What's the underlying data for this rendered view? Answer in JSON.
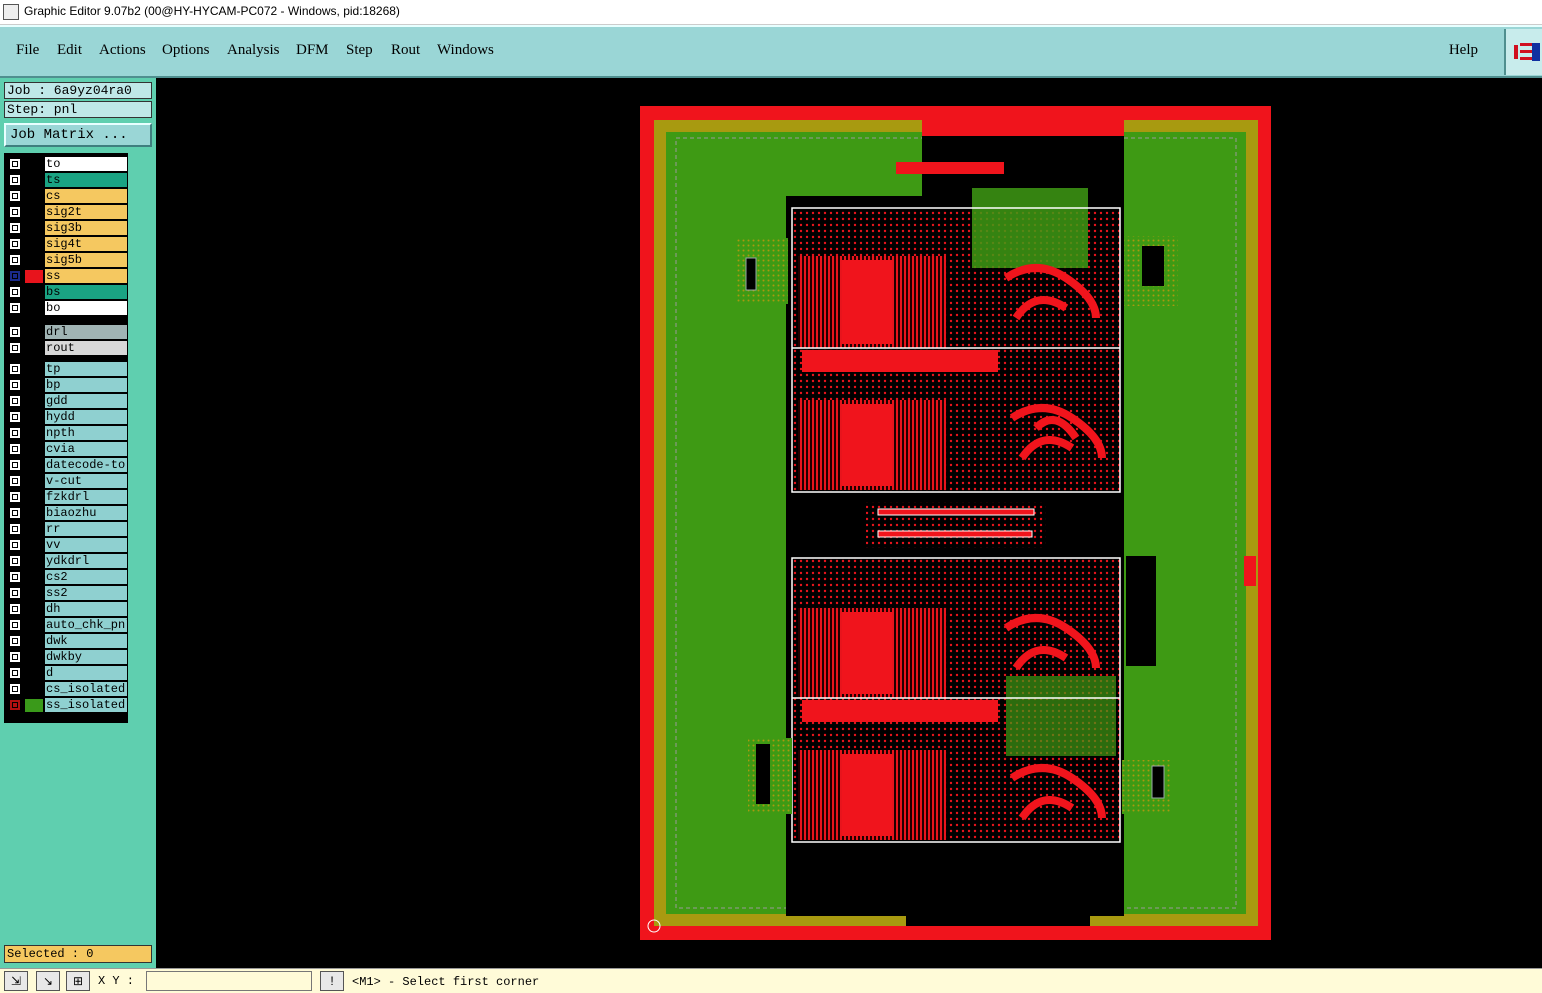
{
  "window": {
    "title": "Graphic Editor 9.07b2 (00@HY-HYCAM-PC072 - Windows, pid:18268)"
  },
  "menu": {
    "items": [
      "File",
      "Edit",
      "Actions",
      "Options",
      "Analysis",
      "DFM",
      "Step",
      "Rout",
      "Windows"
    ],
    "help": "Help"
  },
  "panel": {
    "job": "Job : 6a9yz04ra0",
    "step": "Step: pnl",
    "job_matrix": "Job Matrix ...",
    "selected": "Selected : 0"
  },
  "layers": [
    {
      "name": "to",
      "bg": "#ffffff",
      "swatch": "#000000"
    },
    {
      "name": "ts",
      "bg": "#1aa383",
      "swatch": "#000000"
    },
    {
      "name": "cs",
      "bg": "#f5c860",
      "swatch": "#000000"
    },
    {
      "name": "sig2t",
      "bg": "#f5c860",
      "swatch": "#000000"
    },
    {
      "name": "sig3b",
      "bg": "#f5c860",
      "swatch": "#000000"
    },
    {
      "name": "sig4t",
      "bg": "#f5c860",
      "swatch": "#000000"
    },
    {
      "name": "sig5b",
      "bg": "#f5c860",
      "swatch": "#000000"
    },
    {
      "name": "ss",
      "bg": "#f5c860",
      "swatch": "#e8141c",
      "active": true
    },
    {
      "name": "bs",
      "bg": "#1aa383",
      "swatch": "#000000"
    },
    {
      "name": "bo",
      "bg": "#ffffff",
      "swatch": "#000000"
    },
    {
      "name": "drl",
      "bg": "#a0b4b4",
      "swatch": "#000000"
    },
    {
      "name": "rout",
      "bg": "#d8d8d8",
      "swatch": "#000000"
    },
    {
      "name": "tp",
      "bg": "#8fd0d0",
      "swatch": "#000000"
    },
    {
      "name": "bp",
      "bg": "#8fd0d0",
      "swatch": "#000000"
    },
    {
      "name": "gdd",
      "bg": "#8fd0d0",
      "swatch": "#000000"
    },
    {
      "name": "hydd",
      "bg": "#8fd0d0",
      "swatch": "#000000"
    },
    {
      "name": "npth",
      "bg": "#8fd0d0",
      "swatch": "#000000"
    },
    {
      "name": "cvia",
      "bg": "#8fd0d0",
      "swatch": "#000000"
    },
    {
      "name": "datecode-to",
      "bg": "#8fd0d0",
      "swatch": "#000000"
    },
    {
      "name": "v-cut",
      "bg": "#8fd0d0",
      "swatch": "#000000"
    },
    {
      "name": "fzkdrl",
      "bg": "#8fd0d0",
      "swatch": "#000000"
    },
    {
      "name": "biaozhu",
      "bg": "#8fd0d0",
      "swatch": "#000000"
    },
    {
      "name": "rr",
      "bg": "#8fd0d0",
      "swatch": "#000000"
    },
    {
      "name": "vv",
      "bg": "#8fd0d0",
      "swatch": "#000000"
    },
    {
      "name": "ydkdrl",
      "bg": "#8fd0d0",
      "swatch": "#000000"
    },
    {
      "name": "cs2",
      "bg": "#8fd0d0",
      "swatch": "#000000"
    },
    {
      "name": "ss2",
      "bg": "#8fd0d0",
      "swatch": "#000000"
    },
    {
      "name": "dh",
      "bg": "#8fd0d0",
      "swatch": "#000000"
    },
    {
      "name": "auto_chk_pnl",
      "bg": "#8fd0d0",
      "swatch": "#000000"
    },
    {
      "name": "dwk",
      "bg": "#8fd0d0",
      "swatch": "#000000"
    },
    {
      "name": "dwkby",
      "bg": "#8fd0d0",
      "swatch": "#000000"
    },
    {
      "name": "d",
      "bg": "#8fd0d0",
      "swatch": "#000000"
    },
    {
      "name": "cs_isolated",
      "bg": "#8fd0d0",
      "swatch": "#000000"
    },
    {
      "name": "ss_isolated",
      "bg": "#8fd0d0",
      "swatch": "#3a9a1a",
      "cb_red": true
    }
  ],
  "statusbar": {
    "xy_label": "X Y :",
    "xy_value": "",
    "message": "<M1> - Select first corner"
  },
  "colors": {
    "panel_red": "#f0141c",
    "solder_green": "#3e9a14",
    "mustard": "#a89a10"
  }
}
